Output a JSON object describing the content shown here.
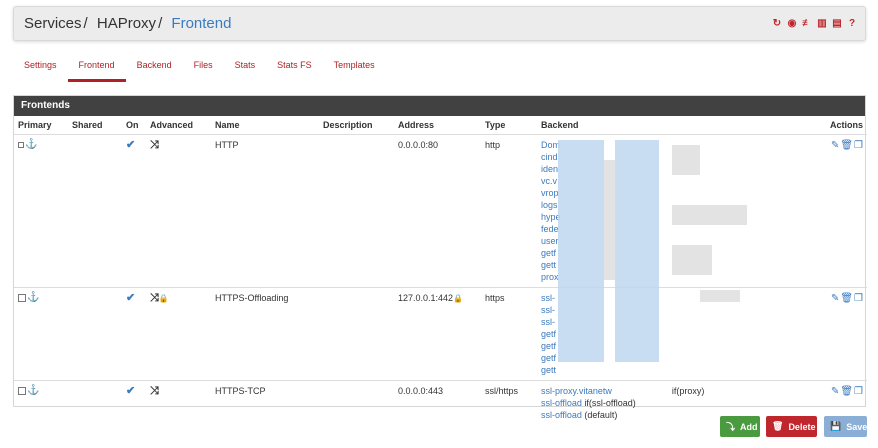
{
  "breadcrumb": {
    "item1": "Services",
    "item2": "HAProxy",
    "item3": "Frontend",
    "sep": "/"
  },
  "header_icons": [
    "reload-icon",
    "stop-icon",
    "settings-icon",
    "chart-icon",
    "list-icon",
    "help-icon"
  ],
  "tabs": [
    {
      "label": "Settings"
    },
    {
      "label": "Frontend"
    },
    {
      "label": "Backend"
    },
    {
      "label": "Files"
    },
    {
      "label": "Stats"
    },
    {
      "label": "Stats FS"
    },
    {
      "label": "Templates"
    }
  ],
  "panel": {
    "title": "Frontends"
  },
  "columns": [
    "Primary",
    "Shared",
    "On",
    "Advanced",
    "Name",
    "Description",
    "Address",
    "Type",
    "Backend",
    "Actions"
  ],
  "rows": [
    {
      "name": "HTTP",
      "description": "",
      "address": "0.0.0.0:80",
      "type": "http",
      "backend": [
        "Dom",
        "cind",
        "iden",
        "vc.v",
        "vrop",
        "logs",
        "hype",
        "fede",
        "user",
        "getf",
        "gett",
        "prox"
      ]
    },
    {
      "name": "HTTPS-Offloading",
      "description": "",
      "address": "127.0.0.1:442",
      "type": "https",
      "backend": [
        "ssl-",
        "ssl-",
        "ssl-",
        "getf",
        "getf",
        "getf",
        "gett"
      ]
    },
    {
      "name": "HTTPS-TCP",
      "description": "",
      "address": "0.0.0.0:443",
      "type": "ssl/https",
      "backend": [
        "ssl-proxy.vitanetw",
        "ssl-offload",
        "ssl-offload"
      ],
      "backend_suffix": [
        "if(proxy)",
        " if(ssl-offload)",
        " (default)"
      ]
    }
  ],
  "buttons": {
    "add": "Add",
    "delete": "Delete",
    "save": "Save"
  },
  "colors": {
    "accent": "#b02127",
    "link": "#3a7abf",
    "panel_header": "#414141",
    "add": "#4a9a3f",
    "delete": "#c0272d",
    "save": "#8aaed6"
  }
}
